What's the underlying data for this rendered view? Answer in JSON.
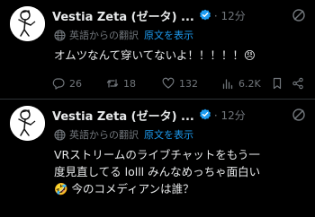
{
  "tweets": [
    {
      "author": "Vestia Zeta (ゼータ) ...",
      "time": "· 12分",
      "translated_label": "英語からの翻訳",
      "show_original": "原文を表示",
      "text": "オムツなんて穿いてないよ！！！！！😠",
      "stats": {
        "replies": "26",
        "retweets": "18",
        "likes": "132",
        "views": "6.2K"
      }
    },
    {
      "author": "Vestia Zeta (ゼータ) ...",
      "time": "· 12分",
      "translated_label": "英語からの翻訳",
      "show_original": "原文を表示",
      "text_lines": [
        "VRストリームのライブチャットをもう一",
        "度見直してる lolll みんなめっちゃ面白い",
        "🤣 今のコメディアンは誰？"
      ]
    }
  ],
  "icons": {
    "verified": "verified-badge-icon",
    "more": "grok-slash-circle-icon",
    "translate": "globe-icon",
    "reply": "reply-icon",
    "retweet": "retweet-icon",
    "like": "heart-icon",
    "views": "views-bar-chart-icon",
    "bookmark": "bookmark-icon",
    "share": "share-icon"
  },
  "colors": {
    "background": "#000000",
    "text": "#e7e9ea",
    "muted": "#71767b",
    "accent": "#1d9bf0",
    "divider": "#2f3336"
  }
}
